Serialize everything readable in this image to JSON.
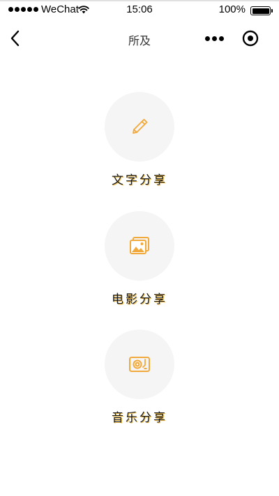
{
  "status_bar": {
    "carrier": "WeChat",
    "time": "15:06",
    "battery": "100%"
  },
  "nav": {
    "title": "所及"
  },
  "share_items": [
    {
      "label": "文字分享",
      "icon": "pen-icon"
    },
    {
      "label": "电影分享",
      "icon": "image-icon"
    },
    {
      "label": "音乐分享",
      "icon": "record-player-icon"
    }
  ],
  "colors": {
    "accent": "#f2a93b",
    "label_shadow": "#f6c452",
    "circle_bg": "#f5f5f5"
  }
}
